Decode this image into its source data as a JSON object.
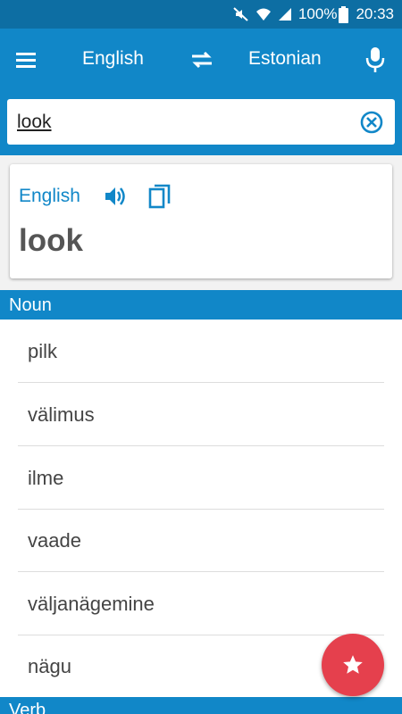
{
  "status_bar": {
    "battery": "100%",
    "time": "20:33",
    "icons": [
      "mute-icon",
      "wifi-icon",
      "signal-icon",
      "battery-icon"
    ]
  },
  "toolbar": {
    "source_language": "English",
    "target_language": "Estonian",
    "icons": [
      "menu-icon",
      "swap-icon",
      "microphone-icon"
    ]
  },
  "search": {
    "value": "look",
    "clear_icon": "clear-circle-icon"
  },
  "entry_card": {
    "language": "English",
    "word": "look",
    "icons": [
      "speaker-icon",
      "copy-icon"
    ]
  },
  "sections": [
    {
      "header": "Noun",
      "items": [
        "pilk",
        "välimus",
        "ilme",
        "vaade",
        "väljanägemine",
        "nägu"
      ]
    },
    {
      "header": "Verb",
      "items": []
    }
  ],
  "fab": {
    "icon": "star-icon"
  },
  "colors": {
    "status_bar": "#0d6ea3",
    "primary": "#1187c8",
    "fab": "#e5404d",
    "word_text": "#555555"
  }
}
